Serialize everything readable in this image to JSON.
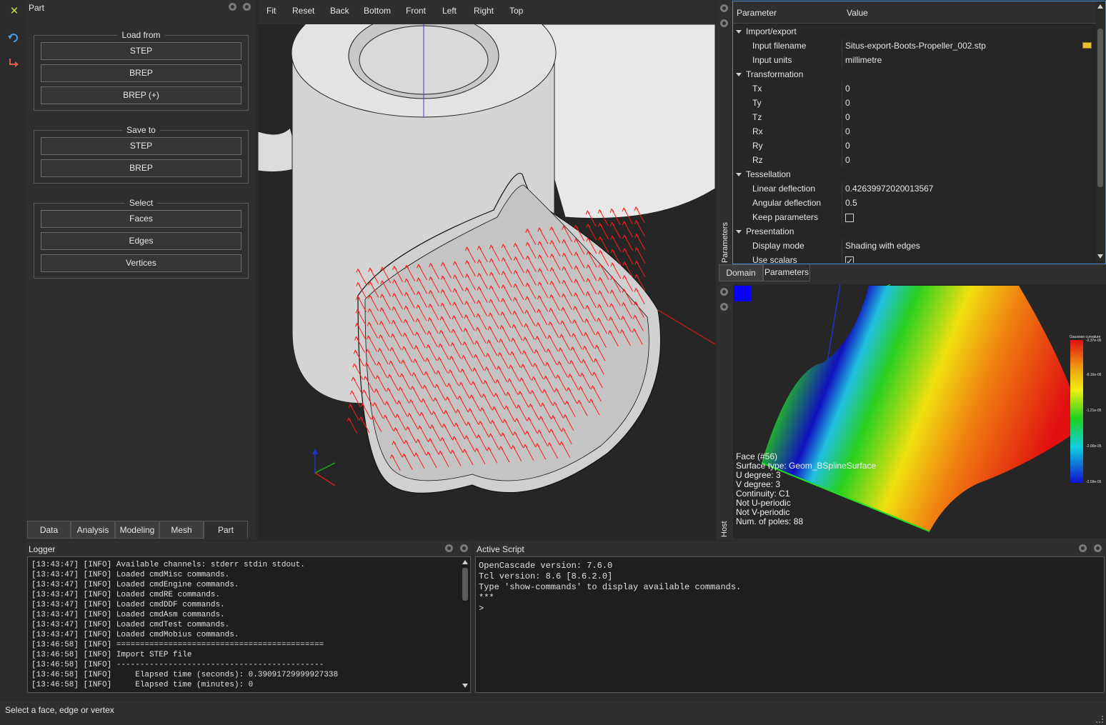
{
  "part_panel": {
    "title": "Part",
    "load_from": {
      "title": "Load from",
      "buttons": [
        "STEP",
        "BREP",
        "BREP (+)"
      ]
    },
    "save_to": {
      "title": "Save to",
      "buttons": [
        "STEP",
        "BREP"
      ]
    },
    "select": {
      "title": "Select",
      "buttons": [
        "Faces",
        "Edges",
        "Vertices"
      ]
    },
    "tabs": [
      "Data",
      "Analysis",
      "Modeling",
      "Mesh",
      "Part"
    ],
    "active_tab": "Part"
  },
  "viewer": {
    "toolbar": [
      "Fit",
      "Reset",
      "Back",
      "Bottom",
      "Front",
      "Left",
      "Right",
      "Top"
    ]
  },
  "parameters": {
    "header": {
      "name": "Parameter",
      "value": "Value"
    },
    "rows": [
      {
        "type": "group",
        "name": "Import/export"
      },
      {
        "type": "prop",
        "name": "Input filename",
        "value": "Situs-export-Boots-Propeller_002.stp",
        "icon": "folder-open-icon"
      },
      {
        "type": "prop",
        "name": "Input units",
        "value": "millimetre"
      },
      {
        "type": "group",
        "name": "Transformation"
      },
      {
        "type": "prop",
        "name": "Tx",
        "value": "0"
      },
      {
        "type": "prop",
        "name": "Ty",
        "value": "0"
      },
      {
        "type": "prop",
        "name": "Tz",
        "value": "0"
      },
      {
        "type": "prop",
        "name": "Rx",
        "value": "0"
      },
      {
        "type": "prop",
        "name": "Ry",
        "value": "0"
      },
      {
        "type": "prop",
        "name": "Rz",
        "value": "0"
      },
      {
        "type": "group",
        "name": "Tessellation"
      },
      {
        "type": "prop",
        "name": "Linear deflection",
        "value": "0.42639972020013567"
      },
      {
        "type": "prop",
        "name": "Angular deflection",
        "value": "0.5"
      },
      {
        "type": "check",
        "name": "Keep parameters",
        "checked": false
      },
      {
        "type": "group",
        "name": "Presentation"
      },
      {
        "type": "prop",
        "name": "Display mode",
        "value": "Shading with edges"
      },
      {
        "type": "check",
        "name": "Use scalars",
        "checked": true
      }
    ],
    "side_label": "Parameters",
    "tabs": [
      "Domain",
      "Parameters"
    ],
    "active_tab": "Parameters"
  },
  "host": {
    "side_label": "Host",
    "info": [
      "Face (#56)",
      "Surface type: Geom_BSplineSurface",
      "U degree: 3",
      "V degree: 3",
      "Continuity: C1",
      "Not U-periodic",
      "Not V-periodic",
      "Num. of poles: 88"
    ],
    "colorbar": {
      "title": "Gaussian curvature",
      "ticks": [
        "-2.37e-05",
        "-8.16e-06",
        "-1.21e-05",
        "-2.00e-05",
        "-2.59e-05"
      ]
    }
  },
  "logger": {
    "title": "Logger",
    "lines": [
      "[13:43:47] [INFO] Available channels: stderr stdin stdout.",
      "[13:43:47] [INFO] Loaded cmdMisc commands.",
      "[13:43:47] [INFO] Loaded cmdEngine commands.",
      "[13:43:47] [INFO] Loaded cmdRE commands.",
      "[13:43:47] [INFO] Loaded cmdDDF commands.",
      "[13:43:47] [INFO] Loaded cmdAsm commands.",
      "[13:43:47] [INFO] Loaded cmdTest commands.",
      "[13:43:47] [INFO] Loaded cmdMobius commands.",
      "[13:46:58] [INFO] ============================================",
      "[13:46:58] [INFO] Import STEP file",
      "[13:46:58] [INFO] --------------------------------------------",
      "[13:46:58] [INFO]     Elapsed time (seconds): 0.39091729999927338",
      "[13:46:58] [INFO]     Elapsed time (minutes): 0"
    ]
  },
  "active_script": {
    "title": "Active Script",
    "lines": [
      "OpenCascade version: 7.6.0",
      "Tcl version: 8.6 [8.6.2.0]",
      "Type 'show-commands' to display available commands.",
      "***",
      ">"
    ]
  },
  "status_bar": {
    "text": "Select a face, edge or vertex"
  },
  "colors": {
    "background": "#2b2b2b",
    "panel": "#2f2f2f",
    "viewer_bg": "#262626",
    "part_gray": "#d9d9d9",
    "normals": "#ff1a1a"
  }
}
